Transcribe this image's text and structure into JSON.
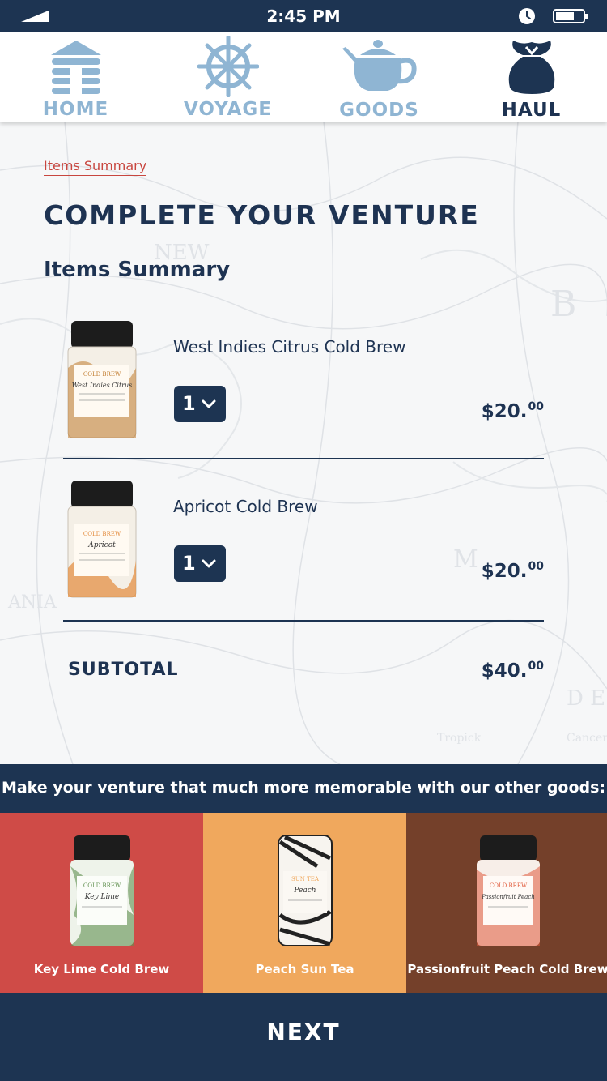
{
  "status_bar": {
    "time": "2:45 PM"
  },
  "nav": {
    "items": [
      {
        "label": "HOME",
        "icon": "log-cabin-icon",
        "active": false
      },
      {
        "label": "VOYAGE",
        "icon": "ship-wheel-icon",
        "active": false
      },
      {
        "label": "GOODS",
        "icon": "teapot-icon",
        "active": false
      },
      {
        "label": "HAUL",
        "icon": "loot-bag-icon",
        "active": true
      }
    ]
  },
  "breadcrumb": "Items Summary",
  "title": "COMPLETE YOUR VENTURE",
  "section_title": "Items Summary",
  "cart": {
    "items": [
      {
        "name": "West Indies Citrus Cold Brew",
        "qty": "1",
        "price_main": "$20.",
        "price_cents": "00",
        "tin_label": "West Indies Citrus",
        "tin_kind": "COLD BREW",
        "accent": "#c07a2c"
      },
      {
        "name": "Apricot Cold Brew",
        "qty": "1",
        "price_main": "$20.",
        "price_cents": "00",
        "tin_label": "Apricot",
        "tin_kind": "COLD BREW",
        "accent": "#e38a3b"
      }
    ],
    "subtotal_label": "SUBTOTAL",
    "subtotal_main": "$40.",
    "subtotal_cents": "00"
  },
  "upsell": {
    "banner": "Make your venture that much more memorable with our other goods:",
    "items": [
      {
        "name": "Key Lime Cold Brew",
        "bg": "#cf4b47",
        "tin_label": "Key Lime",
        "tin_kind": "COLD BREW",
        "accent": "#5f8f4e"
      },
      {
        "name": "Peach Sun Tea",
        "bg": "#f0a85d",
        "tin_label": "Peach",
        "tin_kind": "SUN TEA",
        "accent": "#222222"
      },
      {
        "name": "Passionfruit Peach Cold Brew",
        "bg": "#74402a",
        "tin_label": "Passionfruit Peach",
        "tin_kind": "COLD BREW",
        "accent": "#e05a3a"
      }
    ]
  },
  "next_label": "NEXT",
  "colors": {
    "navy": "#1d3452",
    "light_blue": "#8fb5d3",
    "red": "#c8463f"
  }
}
